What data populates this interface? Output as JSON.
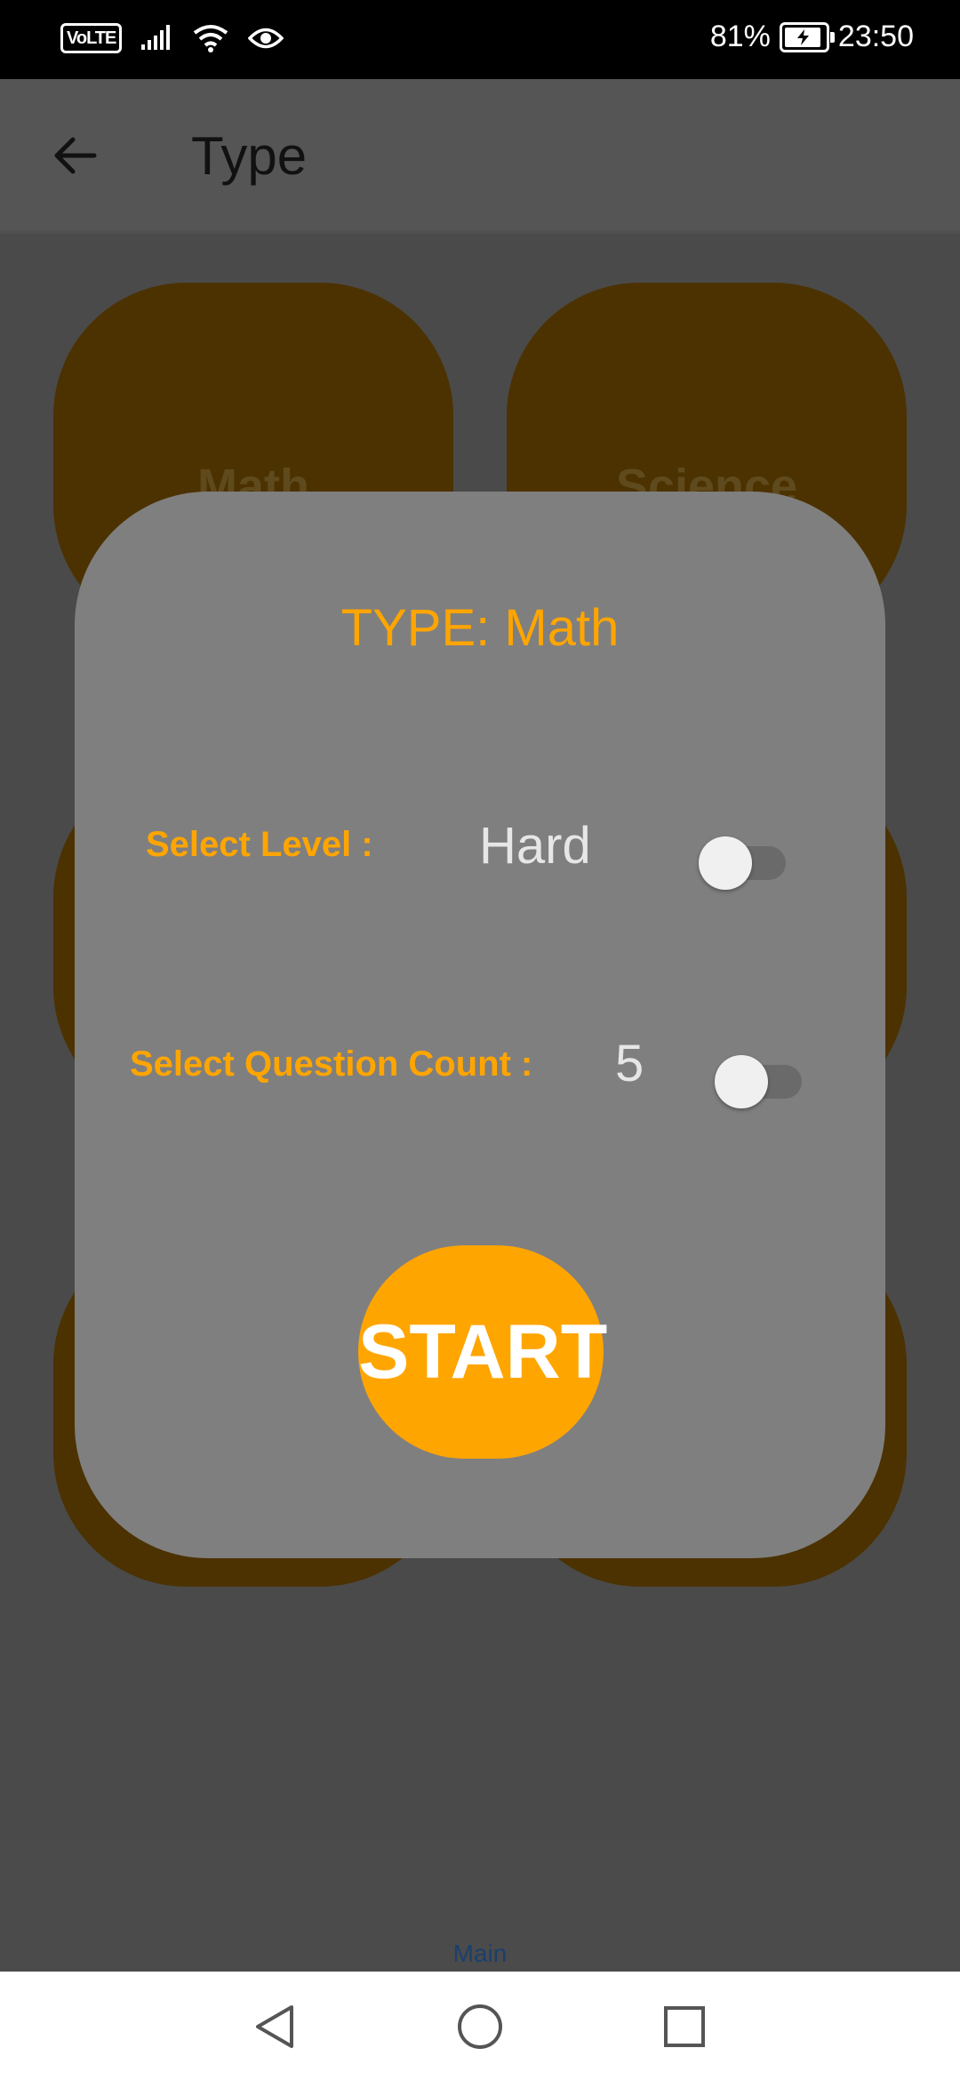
{
  "status_bar": {
    "network_badge": "VoLTE",
    "battery_percent": "81%",
    "battery_level": 81,
    "time": "23:50",
    "icons": [
      "signal-icon",
      "wifi-icon",
      "eye-icon",
      "battery-icon"
    ]
  },
  "app_bar": {
    "title": "Type",
    "back_icon": "arrow-back-icon"
  },
  "categories": [
    {
      "label": "Math"
    },
    {
      "label": "Science"
    },
    {
      "label": ""
    },
    {
      "label": ""
    },
    {
      "label": ""
    },
    {
      "label": ""
    }
  ],
  "dialog": {
    "title": "TYPE: Math",
    "level_label": "Select Level :",
    "level_value": "Hard",
    "level_toggle_on": false,
    "count_label": "Select Question Count :",
    "count_value": "5",
    "count_toggle_on": false,
    "start_label": "START"
  },
  "bottom_nav": {
    "main_label": "Main"
  },
  "system_nav": {
    "icons": [
      "back-triangle-icon",
      "home-circle-icon",
      "recents-square-icon"
    ]
  },
  "colors": {
    "accent": "#ffa500",
    "tile": "#4c3200",
    "dialog": "#7f7f7f"
  }
}
